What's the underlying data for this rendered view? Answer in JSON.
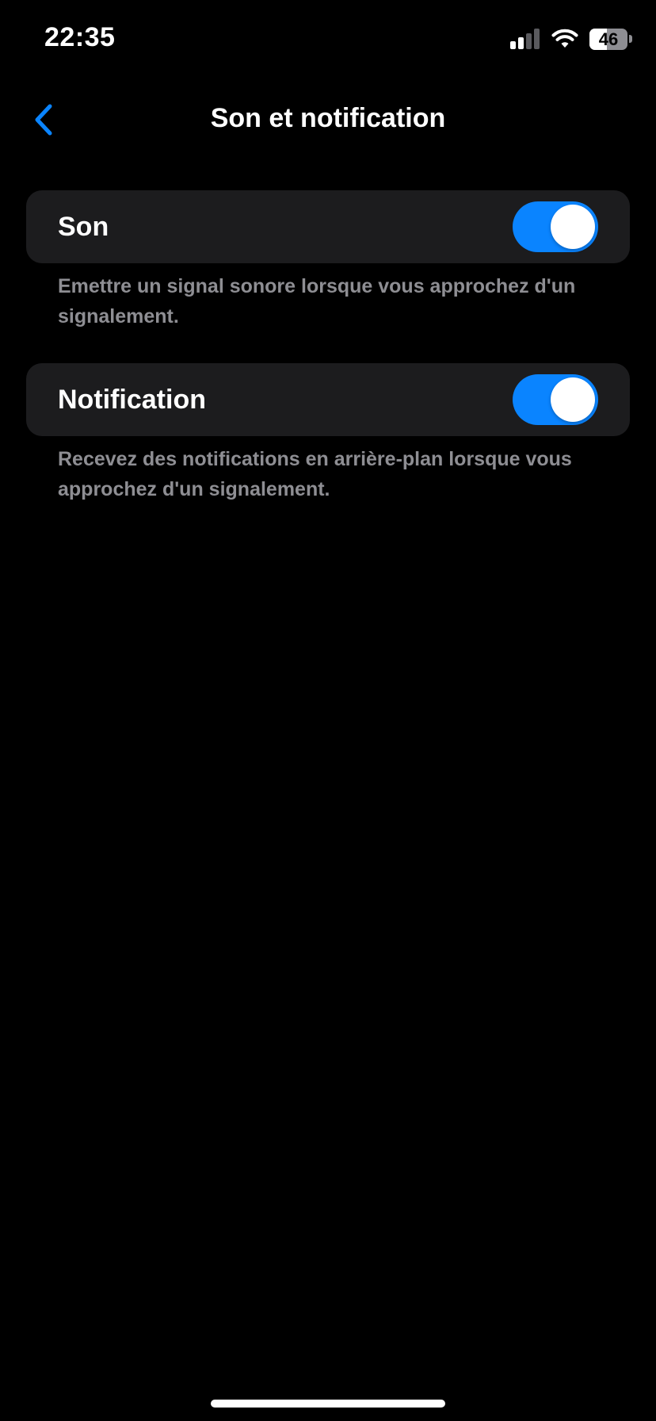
{
  "status_bar": {
    "time": "22:35",
    "battery_level": "46",
    "battery_fraction": 0.46,
    "signal_icon": "cellular-signal-icon",
    "wifi_icon": "wifi-icon"
  },
  "nav": {
    "back_icon": "chevron-left-icon",
    "title": "Son et notification"
  },
  "settings": [
    {
      "label": "Son",
      "enabled": true,
      "description": "Emettre un signal sonore lorsque vous approchez d'un signalement."
    },
    {
      "label": "Notification",
      "enabled": true,
      "description": "Recevez des notifications en arrière-plan lorsque vous approchez d'un signalement."
    }
  ],
  "colors": {
    "background": "#000000",
    "card": "#1c1c1e",
    "accent": "#0a84ff",
    "secondary_text": "#8e8e93"
  }
}
